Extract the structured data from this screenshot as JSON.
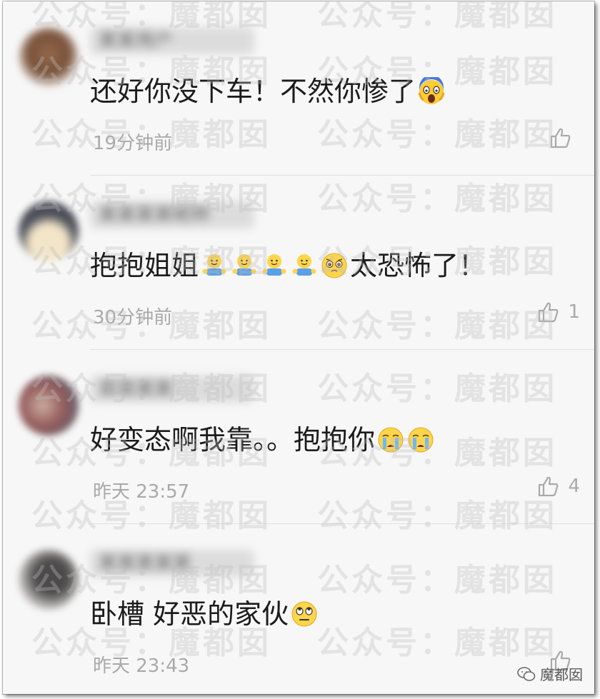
{
  "comments": [
    {
      "name": "某某用户",
      "text_parts": [
        "还好你没下车！不然你惨了"
      ],
      "emojis_after": [
        "scream"
      ],
      "time": "19分钟前",
      "likes": "",
      "avatar_color": "#7a4a2e"
    },
    {
      "name": "某某某某昵称",
      "text_parts": [
        "抱抱姐姐"
      ],
      "emojis_mid": [
        "hug",
        "hug",
        "hug",
        "hug",
        "pleading"
      ],
      "text_after": "太恐怖了！",
      "time": "30分钟前",
      "likes": "1",
      "avatar_color": "#3c3f4a"
    },
    {
      "name": "某某某某",
      "text_parts": [
        "好变态啊我靠。。抱抱你"
      ],
      "emojis_after": [
        "cry",
        "cry"
      ],
      "time": "昨天 23:57",
      "likes": "4",
      "avatar_color": "#8a4b4b"
    },
    {
      "name": "某某某某某",
      "text_parts": [
        "卧槽 好恶的家伙"
      ],
      "emojis_after": [
        "eyeroll"
      ],
      "time": "昨天 23:43",
      "likes": "",
      "avatar_color": "#3a3838"
    }
  ],
  "watermark": "公众号：魔都囡",
  "corner_mark": "魔都囡",
  "colors": {
    "background": "#f7f7f7",
    "meta_text": "#a9a9a9",
    "body_text": "#1c1c1c"
  }
}
